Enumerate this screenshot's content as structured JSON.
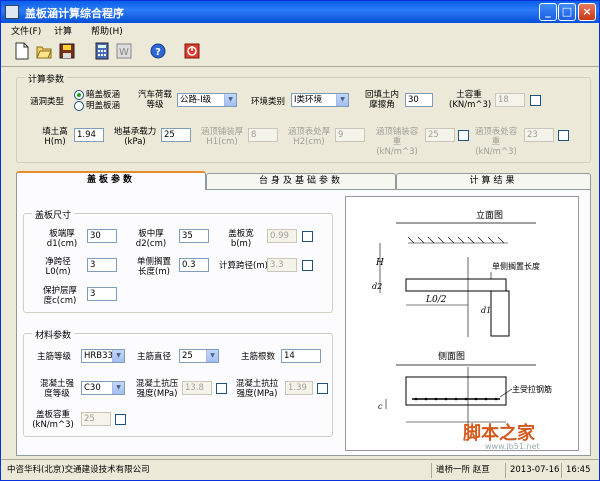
{
  "window": {
    "title": "盖板涵计算综合程序"
  },
  "menu": [
    "文件(F)",
    "计算",
    "帮助(H)"
  ],
  "params": {
    "group_title": "计算参数",
    "culvert_type_label": "涵洞类型",
    "culvert_type_options": [
      "暗盖板涵",
      "明盖板涵"
    ],
    "load_label": "汽车荷载等级",
    "load_value": "公路-I级",
    "env_label": "环境类别",
    "env_value": "I类环境",
    "friction_label": "回填土内摩擦角",
    "friction_value": "30",
    "soil_weight_label": "土容重(KN/m^3)",
    "soil_weight_value": "18",
    "fill_height_label": "填土高H(m)",
    "fill_height_value": "1.94",
    "bearing_label": "地基承载力(kPa)",
    "bearing_value": "25",
    "pave_thick_label": "涵顶铺装厚H1(cm)",
    "pave_thick_value": "8",
    "surface_label": "涵顶表处厚H2(cm)",
    "surface_value": "9",
    "pave_weight_label": "涵顶铺装容重(kN/m^3)",
    "pave_weight_value": "25",
    "surface_weight_label": "涵顶表处容重(kN/m^3)",
    "surface_weight_value": "23"
  },
  "tabs": [
    "盖板参数",
    "台身及基础参数",
    "计算结果"
  ],
  "slab": {
    "group_title": "盖板尺寸",
    "end_thick_label": "板端厚d1(cm)",
    "end_thick_value": "30",
    "mid_thick_label": "板中厚d2(cm)",
    "mid_thick_value": "35",
    "width_label": "盖板宽b(m)",
    "width_value": "0.99",
    "clear_span_label": "净跨径L0(m)",
    "clear_span_value": "3",
    "bearing_len_label": "单侧搁置长度(m)",
    "bearing_len_value": "0.3",
    "calc_span_label": "计算跨径(m)",
    "calc_span_value": "3.3",
    "cover_label": "保护层厚度c(cm)",
    "cover_value": "3"
  },
  "material": {
    "group_title": "材料参数",
    "rebar_grade_label": "主筋等级",
    "rebar_grade_value": "HRB335",
    "rebar_dia_label": "主筋直径",
    "rebar_dia_value": "25",
    "rebar_count_label": "主筋根数",
    "rebar_count_value": "14",
    "concrete_label": "混凝土强度等级",
    "concrete_value": "C30",
    "comp_label": "混凝土抗压强度(MPa)",
    "comp_value": "13.8",
    "tens_label": "混凝土抗拉强度(MPa)",
    "tens_value": "1.39",
    "slab_weight_label": "盖板容重(kN/m^3)",
    "slab_weight_value": "25"
  },
  "diagram": {
    "elevation_title": "立面图",
    "side_title": "侧面图",
    "bearing_note": "单侧搁置长度",
    "rebar_note": "主受拉钢筋",
    "h_label": "H",
    "d2_label": "d2",
    "d1_label": "d1",
    "l0_label": "L0/2",
    "c_label": "c"
  },
  "status": {
    "company": "中咨华科(北京)交通建设技术有限公司",
    "user": "道桥一所 赵亘",
    "date": "2013-07-16",
    "time": "16:45"
  },
  "watermark": {
    "text": "脚本之家",
    "url": "www.jb51.net"
  }
}
